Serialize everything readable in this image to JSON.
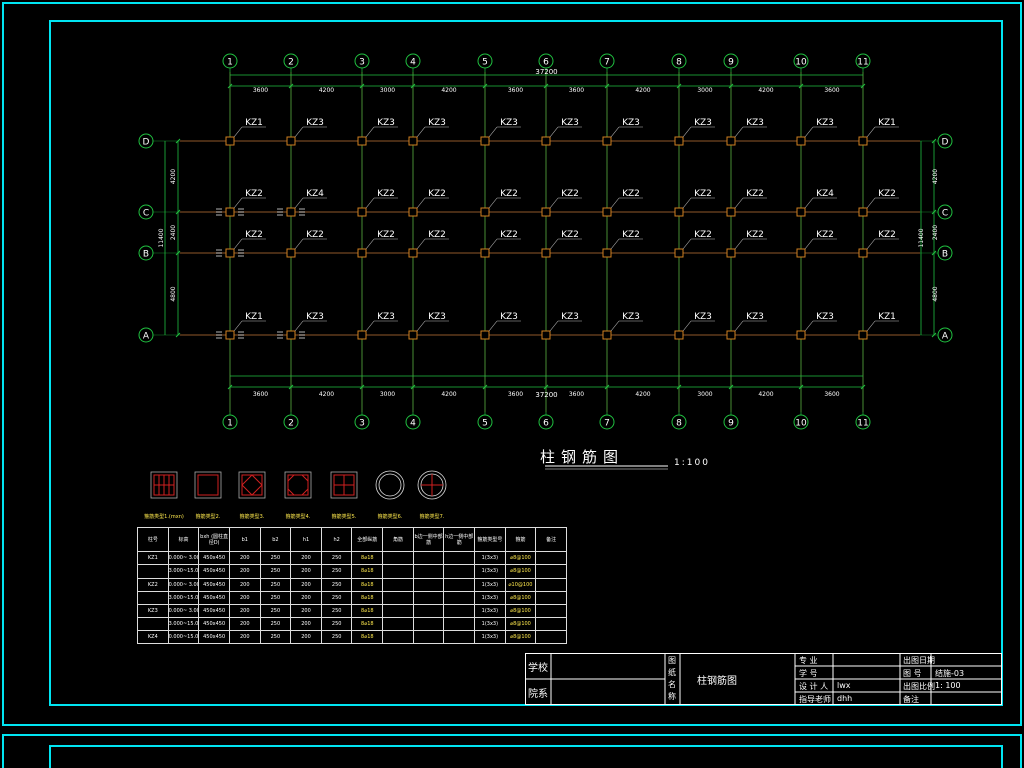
{
  "grid": {
    "x_axes": [
      "1",
      "2",
      "3",
      "4",
      "5",
      "6",
      "7",
      "8",
      "9",
      "10",
      "11"
    ],
    "y_axes": [
      "D",
      "C",
      "B",
      "A"
    ],
    "x_spacings": [
      "3600",
      "4200",
      "3000",
      "4200",
      "3600",
      "3600",
      "4200",
      "3000",
      "4200",
      "3600"
    ],
    "x_total": "37200",
    "y_spacings_left": [
      "4200",
      "2400",
      "4800"
    ],
    "y_total": "11400"
  },
  "columns": {
    "row_D": [
      "KZ1",
      "KZ3",
      "KZ3",
      "KZ3",
      "KZ3",
      "KZ3",
      "KZ3",
      "KZ3",
      "KZ3",
      "KZ3",
      "KZ1"
    ],
    "row_C": [
      "KZ2",
      "KZ4",
      "KZ2",
      "KZ2",
      "KZ2",
      "KZ2",
      "KZ2",
      "KZ2",
      "KZ2",
      "KZ4",
      "KZ2"
    ],
    "row_B": [
      "KZ2",
      "KZ2",
      "KZ2",
      "KZ2",
      "KZ2",
      "KZ2",
      "KZ2",
      "KZ2",
      "KZ2",
      "KZ2",
      "KZ2"
    ],
    "row_A": [
      "KZ1",
      "KZ3",
      "KZ3",
      "KZ3",
      "KZ3",
      "KZ3",
      "KZ3",
      "KZ3",
      "KZ3",
      "KZ3",
      "KZ1"
    ]
  },
  "drawing_title": "柱钢筋图",
  "drawing_scale": "1:100",
  "section_types": [
    {
      "label": "箍筋类型1.(mxn)",
      "shape": "square-grid"
    },
    {
      "label": "箍筋类型2.",
      "shape": "square"
    },
    {
      "label": "箍筋类型3.",
      "shape": "square-diamond"
    },
    {
      "label": "箍筋类型4.",
      "shape": "square-octagon"
    },
    {
      "label": "箍筋类型5.",
      "shape": "square-cross"
    },
    {
      "label": "箍筋类型6.",
      "shape": "circle"
    },
    {
      "label": "箍筋类型7.",
      "shape": "circle-cross"
    }
  ],
  "schedule": {
    "headers": [
      "柱号",
      "标高",
      "bxh (圆柱直径D)",
      "b1",
      "b2",
      "h1",
      "h2",
      "全部纵筋",
      "角筋",
      "b边一侧中部筋",
      "h边一侧中部筋",
      "箍筋类型号",
      "箍筋",
      "备注"
    ],
    "rows": [
      [
        "KZ1",
        "0.000~ 3.000",
        "450x450",
        "200",
        "250",
        "200",
        "250",
        "8⌀18",
        "",
        "",
        "",
        "1(3x3)",
        "⌀8@100",
        ""
      ],
      [
        "",
        "3.000~15.000",
        "450x450",
        "200",
        "250",
        "200",
        "250",
        "8⌀18",
        "",
        "",
        "",
        "1(3x3)",
        "⌀8@100",
        ""
      ],
      [
        "KZ2",
        "0.000~ 3.000",
        "450x450",
        "200",
        "250",
        "200",
        "250",
        "8⌀18",
        "",
        "",
        "",
        "1(3x3)",
        "⌀10@100",
        ""
      ],
      [
        "",
        "3.000~15.000",
        "450x450",
        "200",
        "250",
        "200",
        "250",
        "8⌀18",
        "",
        "",
        "",
        "1(3x3)",
        "⌀8@100",
        ""
      ],
      [
        "KZ3",
        "0.000~ 3.000",
        "450x450",
        "200",
        "250",
        "200",
        "250",
        "8⌀18",
        "",
        "",
        "",
        "1(3x3)",
        "⌀8@100",
        ""
      ],
      [
        "",
        "3.000~15.000",
        "450x450",
        "200",
        "250",
        "200",
        "250",
        "8⌀18",
        "",
        "",
        "",
        "1(3x3)",
        "⌀8@100",
        ""
      ],
      [
        "KZ4",
        "0.000~15.000",
        "450x450",
        "200",
        "250",
        "200",
        "250",
        "8⌀18",
        "",
        "",
        "",
        "1(3x3)",
        "⌀8@100",
        ""
      ]
    ]
  },
  "title_block": {
    "school_label": "学校",
    "dept_label": "院系",
    "drawing_name_label": "图纸名称",
    "drawing_name": "柱钢筋图",
    "major_label": "专  业",
    "student_id_label": "学  号",
    "designer_label": "设 计 人",
    "designer": "lwx",
    "advisor_label": "指导老师",
    "advisor": "dhh",
    "date_label": "出图日期",
    "sheet_no_label": "图  号",
    "sheet_no": "结施-03",
    "scale_label": "出图比例",
    "scale": "1: 100",
    "remark_label": "备注"
  },
  "colors": {
    "frame": "#00e5f2",
    "grid_line": "#d02020",
    "dim_line": "#20c040",
    "column": "#d08020",
    "text": "#ffffff",
    "highlight": "#ffe94d"
  }
}
